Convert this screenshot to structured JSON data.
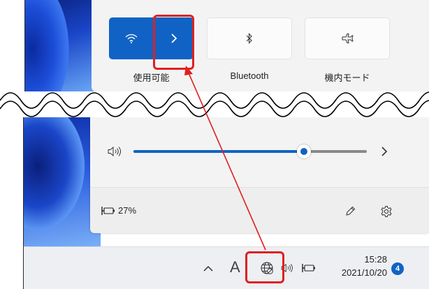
{
  "quick_settings": {
    "wifi_label": "使用可能",
    "bluetooth_label": "Bluetooth",
    "airplane_label": "機内モード",
    "volume_percent": 73,
    "battery_label": "27%"
  },
  "taskbar": {
    "ime_label": "A",
    "time": "15:28",
    "date": "2021/10/20",
    "notification_count": "4"
  },
  "colors": {
    "accent": "#1063c4",
    "highlight": "#e02020",
    "slider_fill": "#1063c4"
  },
  "icons": {
    "wifi": "wifi-icon",
    "expand": "chevron-right-icon",
    "bluetooth": "bluetooth-icon",
    "airplane": "airplane-icon",
    "speaker": "speaker-icon",
    "battery": "battery-charging-icon",
    "edit": "pencil-icon",
    "settings": "gear-icon",
    "tray_overflow": "chevron-up-icon",
    "network": "globe-no-internet-icon"
  }
}
